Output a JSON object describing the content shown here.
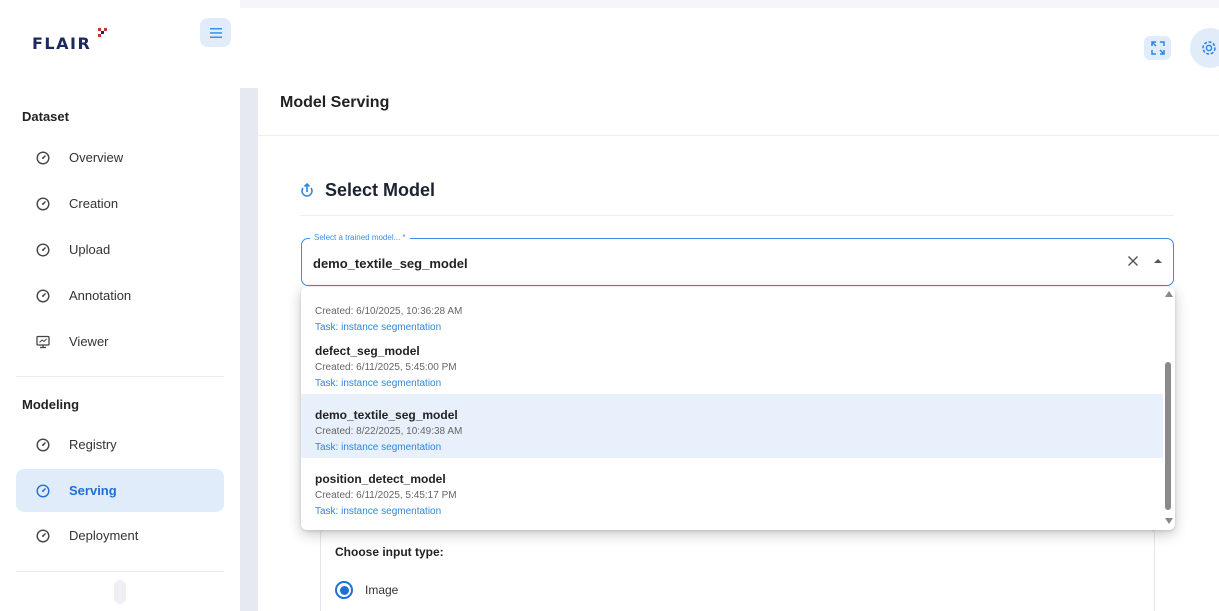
{
  "app": {
    "logo_text": "FLAIR"
  },
  "sidebar": {
    "sections": [
      {
        "title": "Dataset",
        "items": [
          {
            "label": "Overview",
            "icon": "gauge-icon"
          },
          {
            "label": "Creation",
            "icon": "gauge-icon"
          },
          {
            "label": "Upload",
            "icon": "gauge-icon"
          },
          {
            "label": "Annotation",
            "icon": "gauge-icon"
          },
          {
            "label": "Viewer",
            "icon": "monitor-icon"
          }
        ]
      },
      {
        "title": "Modeling",
        "items": [
          {
            "label": "Registry",
            "icon": "gauge-icon"
          },
          {
            "label": "Serving",
            "icon": "gauge-icon",
            "active": true
          },
          {
            "label": "Deployment",
            "icon": "gauge-icon"
          }
        ]
      }
    ]
  },
  "header": {
    "page_title": "Model Serving"
  },
  "select_model": {
    "title": "Select Model",
    "field_label": "Select a trained model... *",
    "value": "demo_textile_seg_model"
  },
  "dropdown": {
    "options": [
      {
        "name": "",
        "created": "Created: 6/10/2025, 10:36:28 AM",
        "task": "Task: instance segmentation"
      },
      {
        "name": "defect_seg_model",
        "created": "Created: 6/11/2025, 5:45:00 PM",
        "task": "Task: instance segmentation"
      },
      {
        "name": "demo_textile_seg_model",
        "created": "Created: 8/22/2025, 10:49:38 AM",
        "task": "Task: instance segmentation",
        "selected": true
      },
      {
        "name": "position_detect_model",
        "created": "Created: 6/11/2025, 5:45:17 PM",
        "task": "Task: instance segmentation"
      }
    ]
  },
  "input_type": {
    "label": "Choose input type:",
    "options": [
      {
        "label": "Image",
        "selected": true
      }
    ]
  },
  "colors": {
    "accent": "#1f6fd6",
    "accent_light": "#e1ecfb",
    "selected_row": "#e7f0fb",
    "link_text": "#2f86dd"
  }
}
